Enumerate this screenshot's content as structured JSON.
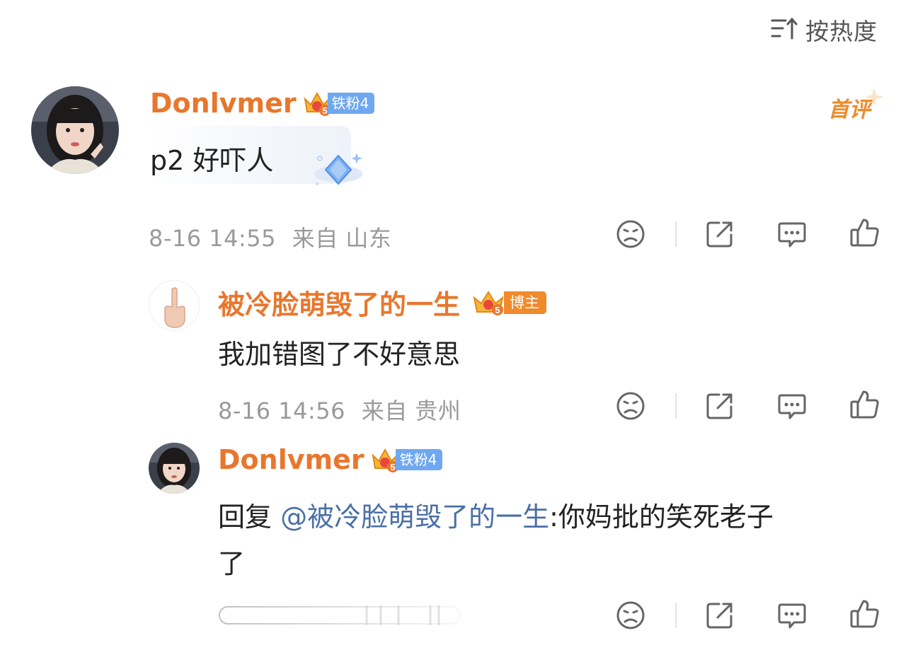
{
  "sort": {
    "label": "按热度",
    "icon": "sort-icon"
  },
  "comments": [
    {
      "user": "Donlvmer",
      "badge": "铁粉4",
      "badge_level": "5",
      "first_tag": "首评",
      "text": "p2 好吓人",
      "time": "8-16 14:55",
      "location": "来自 山东"
    },
    {
      "user": "被冷脸萌毁了的一生",
      "badge": "博主",
      "badge_level": "5",
      "text": "我加错图了不好意思",
      "time": "8-16 14:56",
      "location": "来自 贵州"
    },
    {
      "user": "Donlvmer",
      "badge": "铁粉4",
      "badge_level": "5",
      "reply_prefix": "回复 ",
      "mention": "@被冷脸萌毁了的一生",
      "text_line1": ":你妈批的笑死老子",
      "text_line2": "了"
    }
  ],
  "colors": {
    "username": "#e8772e",
    "mention": "#4a6fa5",
    "meta": "#9a9a9a",
    "fan_badge": "#6fa8f0",
    "host_badge": "#f08a2b"
  }
}
